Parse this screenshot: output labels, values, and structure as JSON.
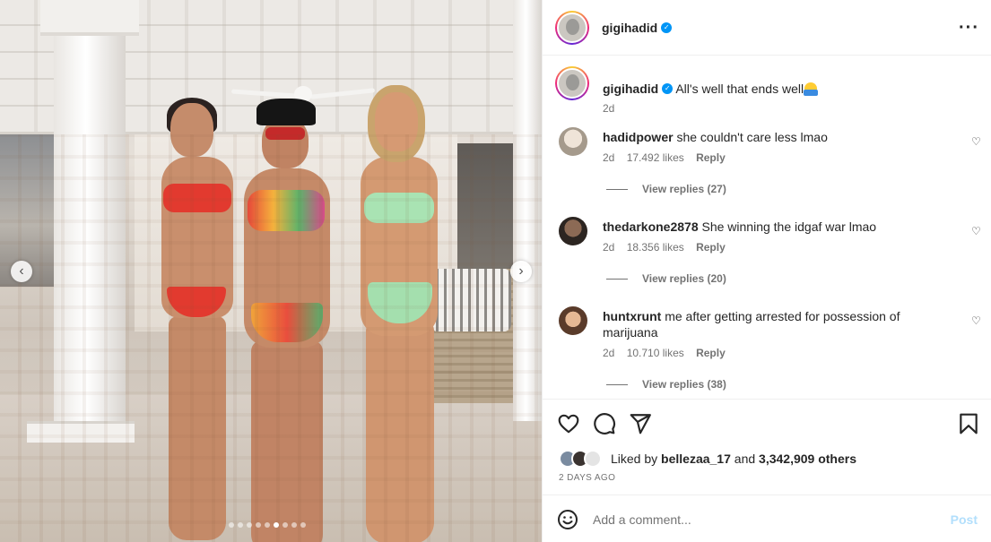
{
  "post": {
    "username": "gigihadid",
    "verified": true,
    "caption": "All's well that ends well",
    "caption_time": "2d",
    "carousel": {
      "total_slides": 9,
      "active_index": 5
    }
  },
  "comments": [
    {
      "username": "hadidpower",
      "text": "she couldn't care less lmao",
      "time": "2d",
      "likes": "17.492 likes",
      "reply": "Reply",
      "view_replies": "View replies (27)"
    },
    {
      "username": "thedarkone2878",
      "text": "She winning the idgaf war lmao",
      "time": "2d",
      "likes": "18.356 likes",
      "reply": "Reply",
      "view_replies": "View replies (20)"
    },
    {
      "username": "huntxrunt",
      "text": "me after getting arrested for possession of marijuana",
      "time": "2d",
      "likes": "10.710 likes",
      "reply": "Reply",
      "view_replies": "View replies (38)"
    }
  ],
  "likes": {
    "prefix": "Liked by",
    "user": "bellezaa_17",
    "connector": "and",
    "others": "3,342,909 others"
  },
  "time_label": "2 DAYS AGO",
  "comment_box": {
    "placeholder": "Add a comment...",
    "post_label": "Post"
  },
  "colors": {
    "verified": "#0095f6",
    "post_disabled": "#b2dffc",
    "muted": "#737373"
  },
  "icons": {
    "more": "more-options-icon",
    "like": "heart-icon",
    "comment": "comment-bubble-icon",
    "share": "send-icon",
    "save": "bookmark-icon",
    "emoji": "smiley-icon"
  }
}
